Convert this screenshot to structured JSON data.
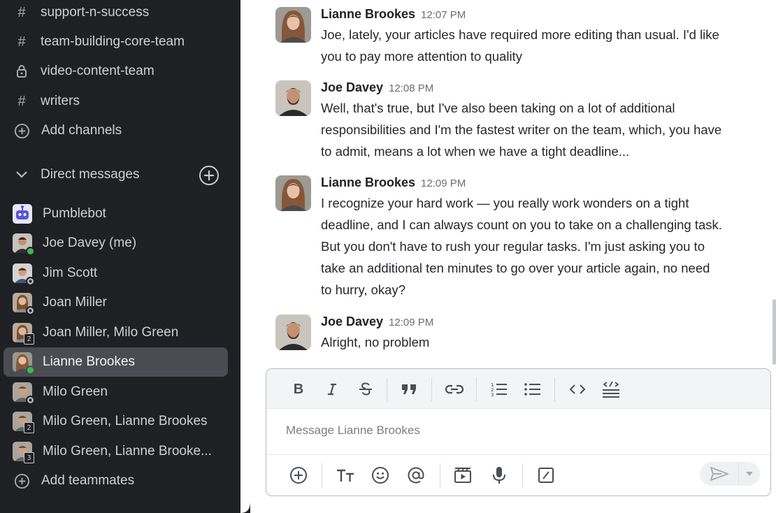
{
  "sidebar": {
    "channels": [
      {
        "icon": "hash-icon",
        "label": "support-n-success"
      },
      {
        "icon": "hash-icon",
        "label": "team-building-core-team"
      },
      {
        "icon": "lock-icon",
        "label": "video-content-team"
      },
      {
        "icon": "hash-icon",
        "label": "writers"
      }
    ],
    "add_channels": "Add channels",
    "dm_header": "Direct messages",
    "dms": [
      {
        "label": "Pumblebot",
        "status": "bot"
      },
      {
        "label": "Joe Davey (me)",
        "status": "online"
      },
      {
        "label": "Jim Scott",
        "status": "offline"
      },
      {
        "label": "Joan Miller",
        "status": "offline"
      },
      {
        "label": "Joan Miller, Milo Green",
        "badge": "2"
      },
      {
        "label": "Lianne Brookes",
        "status": "online",
        "active": true
      },
      {
        "label": "Milo Green",
        "status": "offline"
      },
      {
        "label": "Milo Green, Lianne Brookes",
        "badge": "2"
      },
      {
        "label": "Milo Green, Lianne Brooke...",
        "badge": "3"
      }
    ],
    "add_teammates": "Add teammates"
  },
  "messages": [
    {
      "author": "Lianne Brookes",
      "time": "12:07 PM",
      "lines": [
        "Joe, lately, your articles have required more editing than usual. I'd like",
        "you to pay more attention to quality"
      ]
    },
    {
      "author": "Joe Davey",
      "time": "12:08 PM",
      "lines": [
        "Well, that's true, but I've also been taking on a lot of additional",
        "responsibilities and I'm the fastest writer on the team, which, you have",
        "to admit, means a lot when we have a tight deadline..."
      ]
    },
    {
      "author": "Lianne Brookes",
      "time": "12:09 PM",
      "lines": [
        "I recognize your hard work — you really work wonders on a tight",
        "deadline, and I can always count on you to take on a challenging task.",
        "But you don't have to rush your regular tasks. I'm just asking you to",
        "take an additional ten minutes to go over your article again, no need",
        "to hurry, okay?"
      ]
    },
    {
      "author": "Joe Davey",
      "time": "12:09 PM",
      "lines": [
        "Alright, no problem"
      ]
    }
  ],
  "composer": {
    "placeholder": "Message Lianne Brookes"
  },
  "colors": {
    "sidebar_bg": "#1f2024",
    "active_bg": "#4a4c52",
    "online": "#3db950"
  }
}
